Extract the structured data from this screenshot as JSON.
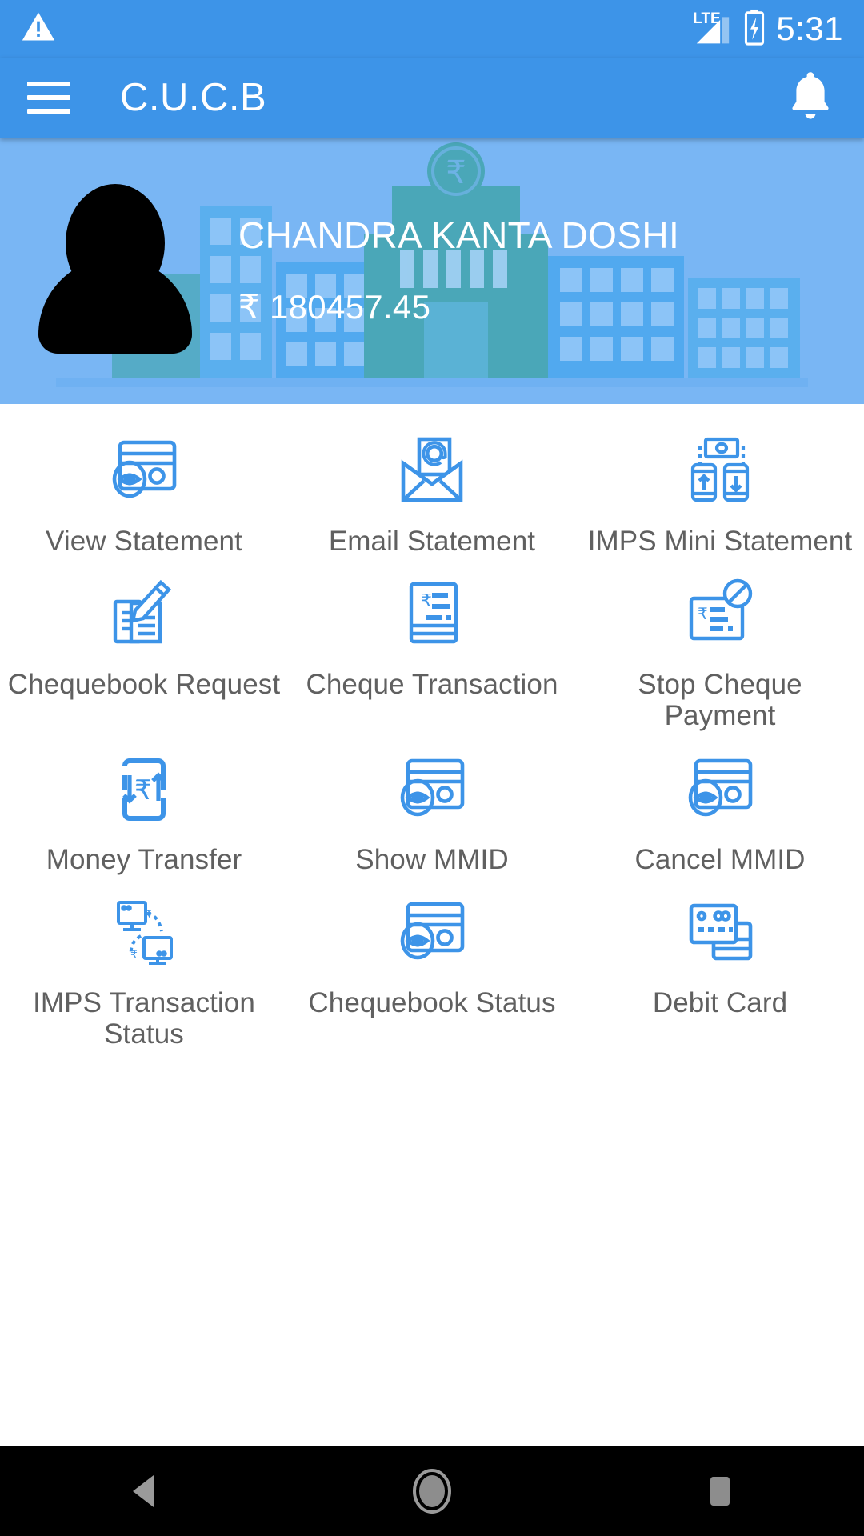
{
  "status_bar": {
    "warning_icon": "warning-triangle-icon",
    "network_label": "LTE",
    "signal_icon": "signal-bars-icon",
    "battery_icon": "battery-charging-icon",
    "time": "5:31"
  },
  "app_bar": {
    "menu_icon": "hamburger-menu-icon",
    "title": "C.U.C.B",
    "notification_icon": "bell-icon"
  },
  "hero": {
    "avatar_icon": "user-avatar-icon",
    "user_name": "CHANDRA KANTA DOSHI",
    "balance": "₹ 180457.45",
    "background_icon": "city-skyline-illustration",
    "bank_symbol": "₹"
  },
  "colors": {
    "primary": "#3d94e8",
    "hero_bg": "#79b6f4",
    "icon_blue": "#3d94e8",
    "label_gray": "#606060",
    "building_teal": "#4aa7b8"
  },
  "menu": {
    "items": [
      {
        "label": "View Statement",
        "icon": "card-eye-icon"
      },
      {
        "label": "Email Statement",
        "icon": "envelope-at-icon"
      },
      {
        "label": "IMPS Mini Statement",
        "icon": "imps-transfer-icon"
      },
      {
        "label": "Chequebook Request",
        "icon": "pen-documents-icon"
      },
      {
        "label": "Cheque Transaction",
        "icon": "cheque-icon"
      },
      {
        "label": "Stop Cheque Payment",
        "icon": "cheque-blocked-icon"
      },
      {
        "label": "Money Transfer",
        "icon": "phone-rupee-arrows-icon"
      },
      {
        "label": "Show MMID",
        "icon": "card-eye-icon"
      },
      {
        "label": "Cancel MMID",
        "icon": "card-eye-icon"
      },
      {
        "label": "IMPS Transaction Status",
        "icon": "monitors-transfer-icon"
      },
      {
        "label": "Chequebook Status",
        "icon": "card-eye-icon"
      },
      {
        "label": "Debit Card",
        "icon": "two-cards-icon"
      }
    ]
  },
  "nav_bar": {
    "back_icon": "back-triangle-icon",
    "home_icon": "home-circle-icon",
    "recents_icon": "recents-square-icon"
  }
}
